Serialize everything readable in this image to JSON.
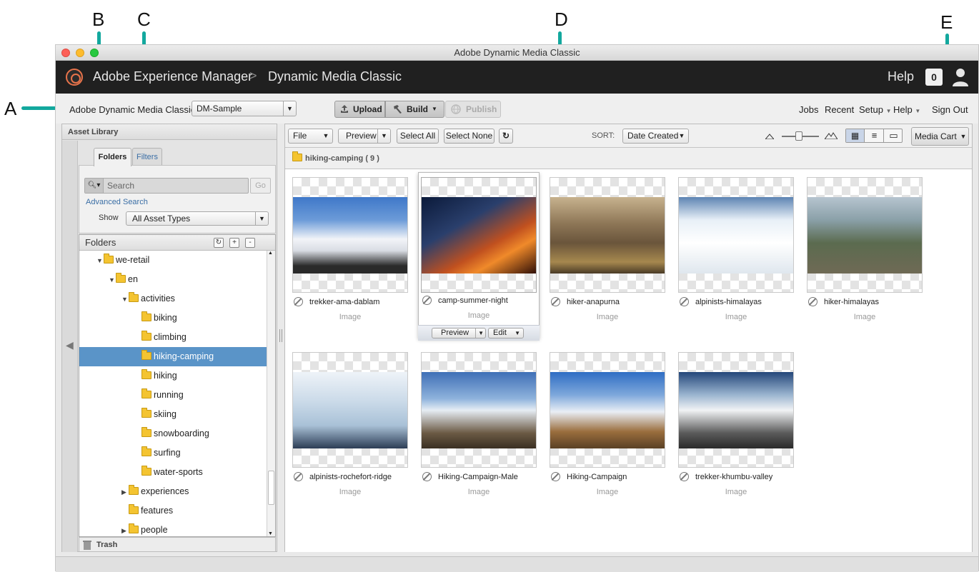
{
  "callouts": [
    "A",
    "B",
    "C",
    "D",
    "E"
  ],
  "window": {
    "title": "Adobe Dynamic Media Classic"
  },
  "appbar": {
    "crumb1": "Adobe Experience Manager",
    "separator": ">",
    "crumb2": "Dynamic Media Classic",
    "help": "Help",
    "badge": "0",
    "icons": {
      "logo": "aem-logo-icon",
      "user": "user-icon"
    }
  },
  "toolbar": {
    "app_label": "Adobe Dynamic Media Classic",
    "company": "DM-Sample",
    "upload": "Upload",
    "build": "Build",
    "publish": "Publish",
    "jobs": "Jobs",
    "recent": "Recent",
    "setup": "Setup",
    "help": "Help",
    "signout": "Sign Out"
  },
  "asset_library": {
    "title": "Asset Library",
    "tabs": [
      "Folders",
      "Filters"
    ],
    "search_placeholder": "Search",
    "go": "Go",
    "advanced_search": "Advanced Search",
    "show_label": "Show",
    "show_value": "All Asset Types",
    "folders_title": "Folders",
    "trash": "Trash",
    "tree": [
      {
        "label": "we-retail",
        "depth": 1,
        "twisty": "▼",
        "open": true
      },
      {
        "label": "en",
        "depth": 2,
        "twisty": "▼",
        "open": true
      },
      {
        "label": "activities",
        "depth": 3,
        "twisty": "▼",
        "open": true
      },
      {
        "label": "biking",
        "depth": 4,
        "twisty": ""
      },
      {
        "label": "climbing",
        "depth": 4,
        "twisty": ""
      },
      {
        "label": "hiking-camping",
        "depth": 4,
        "twisty": "",
        "selected": true
      },
      {
        "label": "hiking",
        "depth": 4,
        "twisty": ""
      },
      {
        "label": "running",
        "depth": 4,
        "twisty": ""
      },
      {
        "label": "skiing",
        "depth": 4,
        "twisty": ""
      },
      {
        "label": "snowboarding",
        "depth": 4,
        "twisty": ""
      },
      {
        "label": "surfing",
        "depth": 4,
        "twisty": ""
      },
      {
        "label": "water-sports",
        "depth": 4,
        "twisty": ""
      },
      {
        "label": "experiences",
        "depth": 3,
        "twisty": "▶"
      },
      {
        "label": "features",
        "depth": 3,
        "twisty": ""
      },
      {
        "label": "people",
        "depth": 3,
        "twisty": "▶"
      }
    ]
  },
  "main": {
    "file": "File",
    "preview": "Preview",
    "select_all": "Select All",
    "select_none": "Select None",
    "sort_label": "SORT:",
    "sort_value": "Date Created",
    "media_cart": "Media Cart",
    "folder_path": "hiking-camping ( 9 )",
    "card_preview": "Preview",
    "card_edit": "Edit",
    "assets": [
      {
        "name": "trekker-ama-dablam",
        "type": "Image"
      },
      {
        "name": "camp-summer-night",
        "type": "Image"
      },
      {
        "name": "hiker-anapurna",
        "type": "Image"
      },
      {
        "name": "alpinists-himalayas",
        "type": "Image"
      },
      {
        "name": "hiker-himalayas",
        "type": "Image"
      },
      {
        "name": "alpinists-rochefort-ridge",
        "type": "Image"
      },
      {
        "name": "Hiking-Campaign-Male",
        "type": "Image"
      },
      {
        "name": "Hiking-Campaign",
        "type": "Image"
      },
      {
        "name": "trekker-khumbu-valley",
        "type": "Image"
      }
    ]
  },
  "colors": {
    "accent_callout": "#13a89e",
    "selected_row": "#5a94c8",
    "appbar_bg": "#202020"
  }
}
